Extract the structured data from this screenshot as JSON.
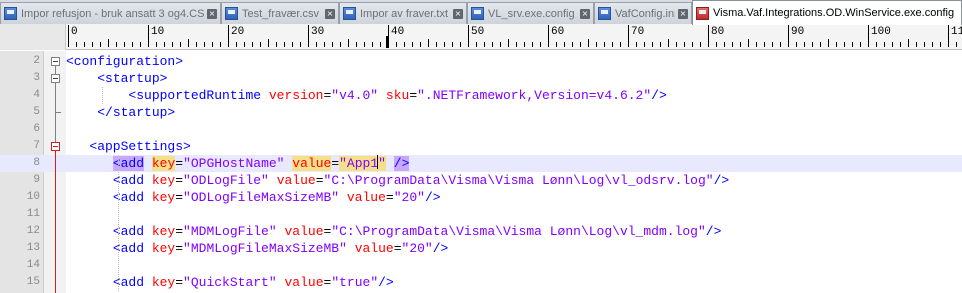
{
  "tabs": [
    {
      "label": "Impor refusjon - bruk ansatt 3 og4.CSV",
      "icon": "file-icon"
    },
    {
      "label": "Test_fravær.csv",
      "icon": "file-icon"
    },
    {
      "label": "Impor av fraver.txt",
      "icon": "file-icon"
    },
    {
      "label": "VL_srv.exe.config",
      "icon": "file-icon"
    },
    {
      "label": "VafConfig.ini",
      "icon": "file-icon"
    },
    {
      "label": "Visma.Vaf.Integrations.OD.WinService.exe.config",
      "icon": "file-icon",
      "active": true
    }
  ],
  "ruler": {
    "labels": [
      "0",
      "10",
      "20",
      "30",
      "40",
      "50",
      "60",
      "70",
      "80",
      "90",
      "100",
      "11"
    ]
  },
  "editor": {
    "current_line": "8",
    "lines": [
      {
        "n": "2",
        "tokens": [
          {
            "t": "<configuration>",
            "c": "tag"
          }
        ]
      },
      {
        "n": "3",
        "tokens": [
          {
            "t": "    ",
            "c": "eq"
          },
          {
            "t": "<startup>",
            "c": "tag"
          }
        ]
      },
      {
        "n": "4",
        "tokens": [
          {
            "t": "        ",
            "c": "eq"
          },
          {
            "t": "<supportedRuntime ",
            "c": "tag"
          },
          {
            "t": "version",
            "c": "attr"
          },
          {
            "t": "=",
            "c": "eq"
          },
          {
            "t": "\"v4.0\"",
            "c": "str"
          },
          {
            "t": " ",
            "c": "eq"
          },
          {
            "t": "sku",
            "c": "attr"
          },
          {
            "t": "=",
            "c": "eq"
          },
          {
            "t": "\".NETFramework,Version=v4.6.2\"",
            "c": "str"
          },
          {
            "t": "/>",
            "c": "tag"
          }
        ]
      },
      {
        "n": "5",
        "tokens": [
          {
            "t": "    ",
            "c": "eq"
          },
          {
            "t": "</startup>",
            "c": "tag"
          }
        ]
      },
      {
        "n": "6",
        "tokens": []
      },
      {
        "n": "7",
        "tokens": [
          {
            "t": "   ",
            "c": "eq"
          },
          {
            "t": "<appSettings>",
            "c": "tag"
          }
        ]
      },
      {
        "n": "8",
        "tokens": [
          {
            "t": "      ",
            "c": "eq"
          },
          {
            "t": "<add",
            "c": "tag",
            "hl": "tag"
          },
          {
            "t": " ",
            "c": "eq"
          },
          {
            "t": "key",
            "c": "attr",
            "hl": "word"
          },
          {
            "t": "=",
            "c": "eq"
          },
          {
            "t": "\"OPGHostName\"",
            "c": "str"
          },
          {
            "t": " ",
            "c": "eq"
          },
          {
            "t": "value",
            "c": "attr",
            "hl": "word"
          },
          {
            "t": "=",
            "c": "eq"
          },
          {
            "t": "\"App1\"",
            "c": "str",
            "hl": "word",
            "caret_before_last": true
          },
          {
            "t": " ",
            "c": "eq"
          },
          {
            "t": "/>",
            "c": "tag",
            "hl": "tag"
          }
        ]
      },
      {
        "n": "9",
        "tokens": [
          {
            "t": "      ",
            "c": "eq"
          },
          {
            "t": "<add ",
            "c": "tag"
          },
          {
            "t": "key",
            "c": "attr"
          },
          {
            "t": "=",
            "c": "eq"
          },
          {
            "t": "\"ODLogFile\"",
            "c": "str"
          },
          {
            "t": " ",
            "c": "eq"
          },
          {
            "t": "value",
            "c": "attr"
          },
          {
            "t": "=",
            "c": "eq"
          },
          {
            "t": "\"C:\\ProgramData\\Visma\\Visma Lønn\\Log\\vl_odsrv.log\"",
            "c": "str"
          },
          {
            "t": "/>",
            "c": "tag"
          }
        ]
      },
      {
        "n": "10",
        "tokens": [
          {
            "t": "      ",
            "c": "eq"
          },
          {
            "t": "<add ",
            "c": "tag"
          },
          {
            "t": "key",
            "c": "attr"
          },
          {
            "t": "=",
            "c": "eq"
          },
          {
            "t": "\"ODLogFileMaxSizeMB\"",
            "c": "str"
          },
          {
            "t": " ",
            "c": "eq"
          },
          {
            "t": "value",
            "c": "attr"
          },
          {
            "t": "=",
            "c": "eq"
          },
          {
            "t": "\"20\"",
            "c": "str"
          },
          {
            "t": "/>",
            "c": "tag"
          }
        ]
      },
      {
        "n": "11",
        "tokens": []
      },
      {
        "n": "12",
        "tokens": [
          {
            "t": "      ",
            "c": "eq"
          },
          {
            "t": "<add ",
            "c": "tag"
          },
          {
            "t": "key",
            "c": "attr"
          },
          {
            "t": "=",
            "c": "eq"
          },
          {
            "t": "\"MDMLogFile\"",
            "c": "str"
          },
          {
            "t": " ",
            "c": "eq"
          },
          {
            "t": "value",
            "c": "attr"
          },
          {
            "t": "=",
            "c": "eq"
          },
          {
            "t": "\"C:\\ProgramData\\Visma\\Visma Lønn\\Log\\vl_mdm.log\"",
            "c": "str"
          },
          {
            "t": "/>",
            "c": "tag"
          }
        ]
      },
      {
        "n": "13",
        "tokens": [
          {
            "t": "      ",
            "c": "eq"
          },
          {
            "t": "<add ",
            "c": "tag"
          },
          {
            "t": "key",
            "c": "attr"
          },
          {
            "t": "=",
            "c": "eq"
          },
          {
            "t": "\"MDMLogFileMaxSizeMB\"",
            "c": "str"
          },
          {
            "t": " ",
            "c": "eq"
          },
          {
            "t": "value",
            "c": "attr"
          },
          {
            "t": "=",
            "c": "eq"
          },
          {
            "t": "\"20\"",
            "c": "str"
          },
          {
            "t": "/>",
            "c": "tag"
          }
        ]
      },
      {
        "n": "14",
        "tokens": []
      },
      {
        "n": "15",
        "tokens": [
          {
            "t": "      ",
            "c": "eq"
          },
          {
            "t": "<add ",
            "c": "tag"
          },
          {
            "t": "key",
            "c": "attr"
          },
          {
            "t": "=",
            "c": "eq"
          },
          {
            "t": "\"QuickStart\"",
            "c": "str"
          },
          {
            "t": " ",
            "c": "eq"
          },
          {
            "t": "value",
            "c": "attr"
          },
          {
            "t": "=",
            "c": "eq"
          },
          {
            "t": "\"true\"",
            "c": "str"
          },
          {
            "t": "/>",
            "c": "tag"
          }
        ]
      }
    ]
  },
  "colors": {
    "tag": "#0000ff",
    "attribute": "#ff0000",
    "string": "#8000ff",
    "current_line": "#e8e8ff",
    "fold_marker_active": "#d02020"
  }
}
